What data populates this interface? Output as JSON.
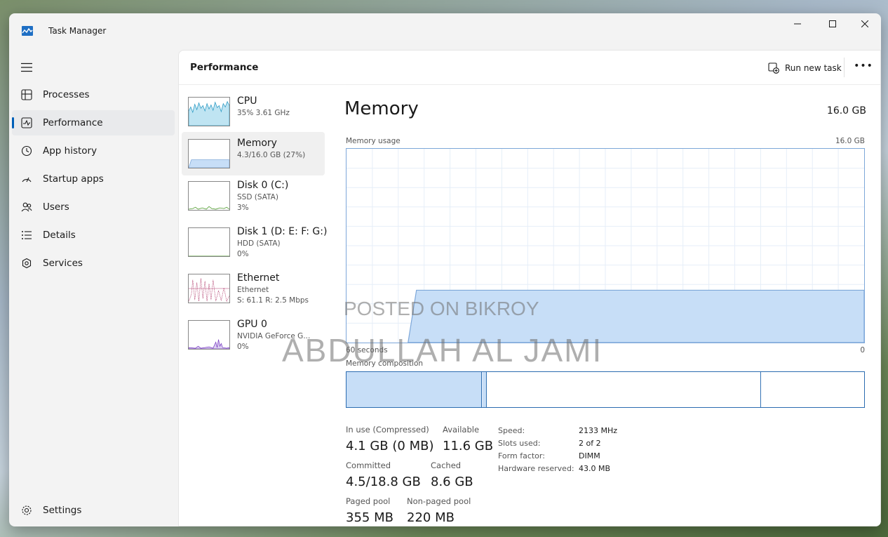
{
  "window": {
    "title": "Task Manager"
  },
  "titlebar": {
    "minimize": "—",
    "maximize": "☐",
    "close": "✕"
  },
  "nav": {
    "items": [
      {
        "label": "Processes",
        "icon": "processes-icon"
      },
      {
        "label": "Performance",
        "icon": "performance-icon",
        "active": true
      },
      {
        "label": "App history",
        "icon": "app-history-icon"
      },
      {
        "label": "Startup apps",
        "icon": "startup-apps-icon"
      },
      {
        "label": "Users",
        "icon": "users-icon"
      },
      {
        "label": "Details",
        "icon": "details-icon"
      },
      {
        "label": "Services",
        "icon": "services-icon"
      }
    ],
    "settings": "Settings"
  },
  "header": {
    "title": "Performance",
    "run_new_task": "Run new task",
    "more": "•••"
  },
  "perf_list": [
    {
      "name": "CPU",
      "sub": "35%  3.61 GHz",
      "sub2": ""
    },
    {
      "name": "Memory",
      "sub": "4.3/16.0 GB (27%)",
      "sub2": ""
    },
    {
      "name": "Disk 0 (C:)",
      "sub": "SSD (SATA)",
      "sub2": "3%"
    },
    {
      "name": "Disk 1 (D: E: F: G:)",
      "sub": "HDD (SATA)",
      "sub2": "0%"
    },
    {
      "name": "Ethernet",
      "sub": "Ethernet",
      "sub2": "S: 61.1  R: 2.5 Mbps"
    },
    {
      "name": "GPU 0",
      "sub": "NVIDIA GeForce G...",
      "sub2": "0%"
    }
  ],
  "memory": {
    "title": "Memory",
    "total": "16.0 GB",
    "usage_label": "Memory usage",
    "usage_max": "16.0 GB",
    "axis_left": "60 seconds",
    "axis_right": "0",
    "composition_label": "Memory composition",
    "usage_fraction": 0.27,
    "stats": {
      "in_use_label": "In use (Compressed)",
      "in_use": "4.1 GB (0 MB)",
      "available_label": "Available",
      "available": "11.6 GB",
      "committed_label": "Committed",
      "committed": "4.5/18.8 GB",
      "cached_label": "Cached",
      "cached": "8.6 GB",
      "paged_label": "Paged pool",
      "paged": "355 MB",
      "nonpaged_label": "Non-paged pool",
      "nonpaged": "220 MB"
    },
    "specs": {
      "speed_label": "Speed:",
      "speed": "2133 MHz",
      "slots_label": "Slots used:",
      "slots": "2 of 2",
      "form_label": "Form factor:",
      "form": "DIMM",
      "reserved_label": "Hardware reserved:",
      "reserved": "43.0 MB"
    }
  },
  "watermarks": {
    "line1": "POSTED ON BIKROY",
    "line2": "ABDULLAH AL JAMI"
  },
  "colors": {
    "accent": "#005fb8",
    "memory_fill": "#c7def7",
    "memory_line": "#7da7d9",
    "cpu": "#2b9ac4",
    "disk": "#4c9a2a",
    "ethernet": "#b0386a",
    "gpu": "#7b3fc4"
  }
}
